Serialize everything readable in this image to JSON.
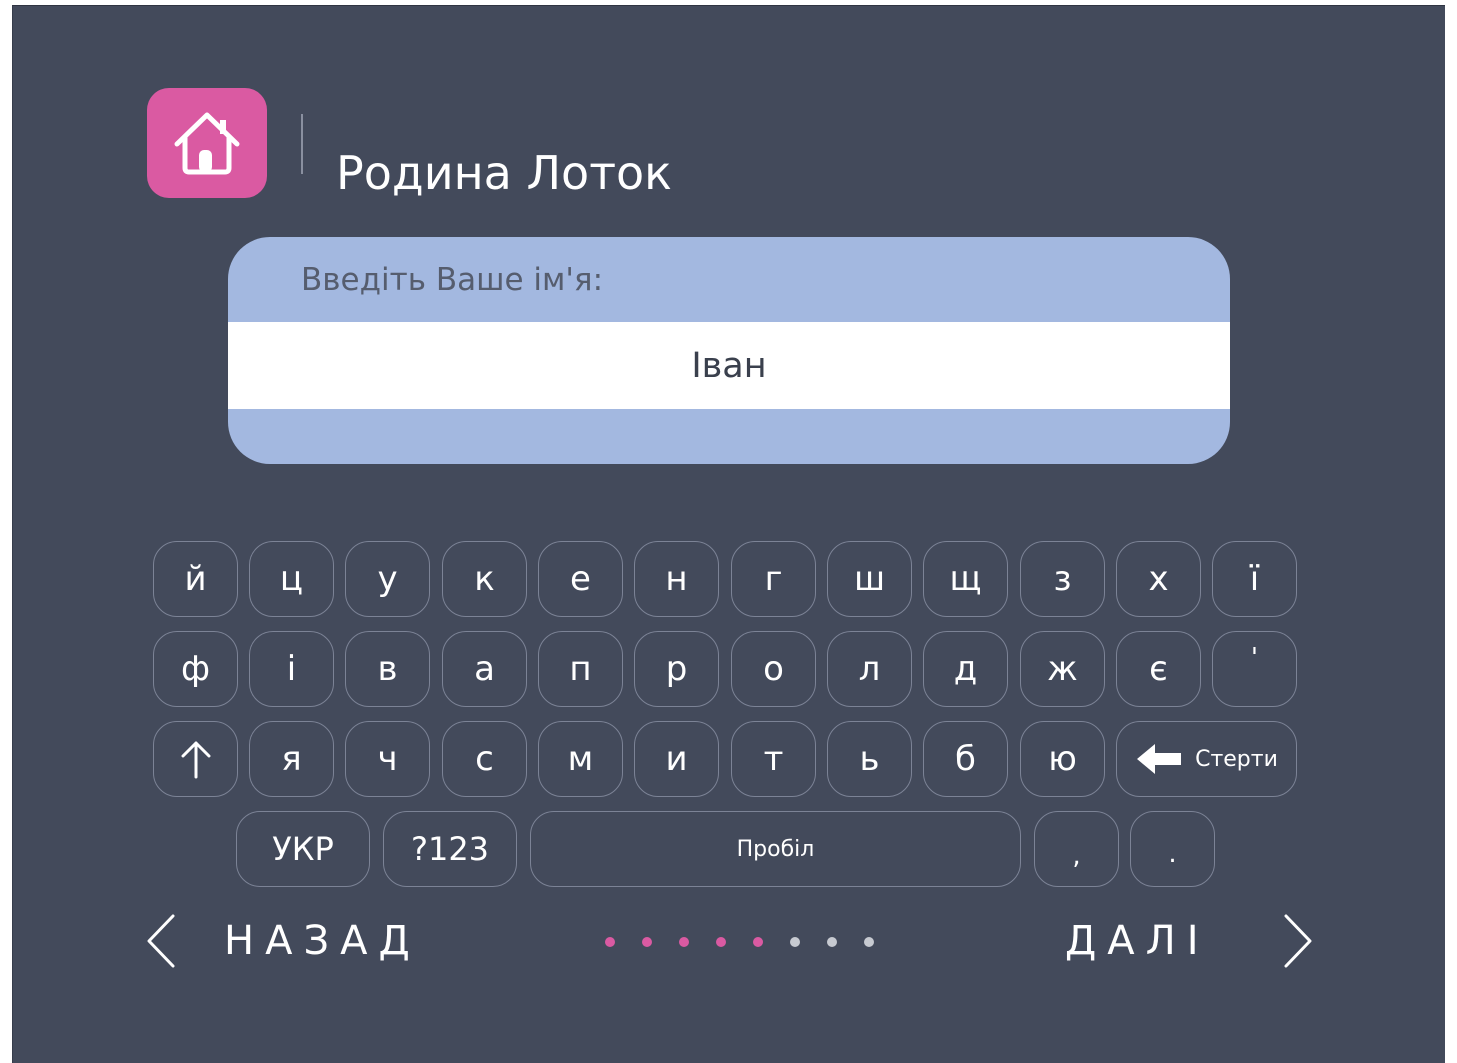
{
  "header": {
    "title": "Родина Лоток",
    "icon": "home-icon",
    "icon_bg": "#da5aa2"
  },
  "name_form": {
    "prompt": "Введіть Ваше ім'я:",
    "value": "Іван",
    "card_color": "#a3b8e0"
  },
  "keyboard": {
    "rows": [
      [
        "й",
        "ц",
        "у",
        "к",
        "е",
        "н",
        "г",
        "ш",
        "щ",
        "з",
        "х",
        "ї"
      ],
      [
        "ф",
        "і",
        "в",
        "а",
        "п",
        "р",
        "о",
        "л",
        "д",
        "ж",
        "є",
        "'"
      ],
      [
        "я",
        "ч",
        "с",
        "м",
        "и",
        "т",
        "ь",
        "б",
        "ю"
      ]
    ],
    "shift_icon": "arrow-up-icon",
    "backspace_icon": "arrow-left-icon",
    "backspace_label": "Стерти",
    "lang_label": "УКР",
    "numbers_label": "?123",
    "space_label": "Пробіл",
    "comma_label": ",",
    "period_label": "."
  },
  "navigation": {
    "back_label": "НАЗАД",
    "back_icon": "chevron-left-icon",
    "next_label": "ДАЛІ",
    "next_icon": "chevron-right-icon"
  },
  "progress": {
    "total_steps": 8,
    "current_step": 5,
    "active_color": "#da5aa2",
    "inactive_color": "#c7cad1"
  },
  "colors": {
    "background": "#434a5b",
    "key_border": "#7c8396"
  }
}
